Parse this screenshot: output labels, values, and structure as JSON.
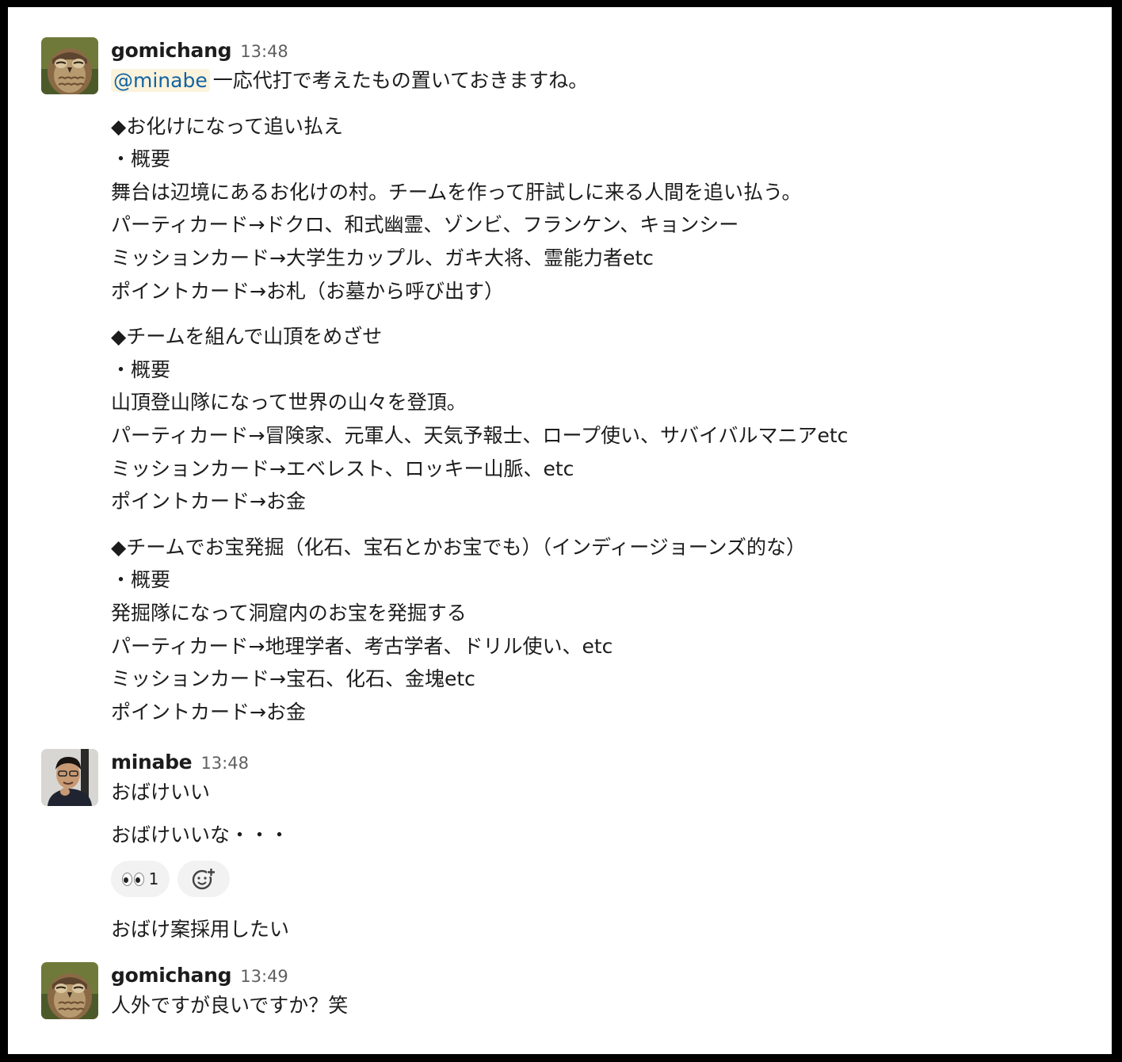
{
  "messages": [
    {
      "author": "gomichang",
      "time": "13:48",
      "avatar": "owl-avatar",
      "mention": "@minabe",
      "first_line": "一応代打で考えたもの置いておきますね。",
      "sections": [
        [
          "◆お化けになって追い払え",
          "・概要",
          "舞台は辺境にあるお化けの村。チームを作って肝試しに来る人間を追い払う。",
          "パーティカード→ドクロ、和式幽霊、ゾンビ、フランケン、キョンシー",
          "ミッションカード→大学生カップル、ガキ大将、霊能力者etc",
          "ポイントカード→お札（お墓から呼び出す）"
        ],
        [
          "◆チームを組んで山頂をめざせ",
          "・概要",
          "山頂登山隊になって世界の山々を登頂。",
          "パーティカード→冒険家、元軍人、天気予報士、ロープ使い、サバイバルマニアetc",
          "ミッションカード→エベレスト、ロッキー山脈、etc",
          "ポイントカード→お金"
        ],
        [
          "◆チームでお宝発掘（化石、宝石とかお宝でも）（インディージョーンズ的な）",
          "・概要",
          "発掘隊になって洞窟内のお宝を発掘する",
          "パーティカード→地理学者、考古学者、ドリル使い、etc",
          "ミッションカード→宝石、化石、金塊etc",
          "ポイントカード→お金"
        ]
      ]
    },
    {
      "author": "minabe",
      "time": "13:48",
      "avatar": "person-avatar",
      "lines": [
        "おばけいい",
        "おばけいいな・・・"
      ],
      "reactions": [
        {
          "emoji": "eyes",
          "count": "1"
        },
        {
          "emoji": "add-reaction-icon",
          "count": ""
        }
      ],
      "after_reactions": "おばけ案採用したい"
    },
    {
      "author": "gomichang",
      "time": "13:49",
      "avatar": "owl-avatar",
      "lines": [
        "人外ですが良いですか？笑"
      ]
    }
  ]
}
